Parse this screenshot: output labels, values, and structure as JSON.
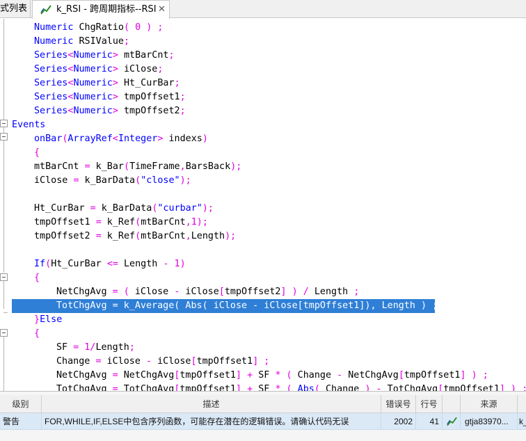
{
  "tabs": [
    {
      "label": "式列表"
    },
    {
      "label": "k_RSI - 跨周期指标--RSI",
      "close": "✕"
    }
  ],
  "code_lines": [
    {
      "indent": 1,
      "parts": [
        [
          "kw",
          "Numeric"
        ],
        [
          "fn",
          " ChgRatio"
        ],
        [
          "op",
          "( 0 ) ;"
        ]
      ]
    },
    {
      "indent": 1,
      "parts": [
        [
          "kw",
          "Numeric"
        ],
        [
          "fn",
          " RSIValue"
        ],
        [
          "op",
          ";"
        ]
      ]
    },
    {
      "indent": 1,
      "parts": [
        [
          "kw",
          "Series"
        ],
        [
          "op",
          "<"
        ],
        [
          "kw",
          "Numeric"
        ],
        [
          "op",
          ">"
        ],
        [
          "fn",
          " mtBarCnt"
        ],
        [
          "op",
          ";"
        ]
      ]
    },
    {
      "indent": 1,
      "parts": [
        [
          "kw",
          "Series"
        ],
        [
          "op",
          "<"
        ],
        [
          "kw",
          "Numeric"
        ],
        [
          "op",
          ">"
        ],
        [
          "fn",
          " iClose"
        ],
        [
          "op",
          ";"
        ]
      ]
    },
    {
      "indent": 1,
      "parts": [
        [
          "kw",
          "Series"
        ],
        [
          "op",
          "<"
        ],
        [
          "kw",
          "Numeric"
        ],
        [
          "op",
          ">"
        ],
        [
          "fn",
          " Ht_CurBar"
        ],
        [
          "op",
          ";"
        ]
      ]
    },
    {
      "indent": 1,
      "parts": [
        [
          "kw",
          "Series"
        ],
        [
          "op",
          "<"
        ],
        [
          "kw",
          "Numeric"
        ],
        [
          "op",
          ">"
        ],
        [
          "fn",
          " tmpOffset1"
        ],
        [
          "op",
          ";"
        ]
      ]
    },
    {
      "indent": 1,
      "parts": [
        [
          "kw",
          "Series"
        ],
        [
          "op",
          "<"
        ],
        [
          "kw",
          "Numeric"
        ],
        [
          "op",
          ">"
        ],
        [
          "fn",
          " tmpOffset2"
        ],
        [
          "op",
          ";"
        ]
      ]
    },
    {
      "indent": 0,
      "parts": [
        [
          "kw",
          "Events"
        ]
      ]
    },
    {
      "indent": 1,
      "parts": [
        [
          "kw",
          "onBar"
        ],
        [
          "op",
          "("
        ],
        [
          "kw",
          "ArrayRef"
        ],
        [
          "op",
          "<"
        ],
        [
          "kw",
          "Integer"
        ],
        [
          "op",
          ">"
        ],
        [
          "fn",
          " indexs"
        ],
        [
          "op",
          ")"
        ]
      ]
    },
    {
      "indent": 1,
      "parts": [
        [
          "op",
          "{"
        ]
      ]
    },
    {
      "indent": 1,
      "parts": [
        [
          "fn",
          "mtBarCnt "
        ],
        [
          "op",
          "="
        ],
        [
          "fn",
          " k_Bar"
        ],
        [
          "op",
          "("
        ],
        [
          "fn",
          "TimeFrame"
        ],
        [
          "op",
          ","
        ],
        [
          "fn",
          "BarsBack"
        ],
        [
          "op",
          ");"
        ]
      ]
    },
    {
      "indent": 1,
      "parts": [
        [
          "fn",
          "iClose "
        ],
        [
          "op",
          "="
        ],
        [
          "fn",
          " k_BarData"
        ],
        [
          "op",
          "("
        ],
        [
          "str",
          "\"close\""
        ],
        [
          "op",
          ");"
        ]
      ]
    },
    {
      "indent": 1,
      "parts": []
    },
    {
      "indent": 1,
      "parts": [
        [
          "fn",
          "Ht_CurBar "
        ],
        [
          "op",
          "="
        ],
        [
          "fn",
          " k_BarData"
        ],
        [
          "op",
          "("
        ],
        [
          "str",
          "\"curbar\""
        ],
        [
          "op",
          ");"
        ]
      ]
    },
    {
      "indent": 1,
      "parts": [
        [
          "fn",
          "tmpOffset1 "
        ],
        [
          "op",
          "="
        ],
        [
          "fn",
          " k_Ref"
        ],
        [
          "op",
          "("
        ],
        [
          "fn",
          "mtBarCnt"
        ],
        [
          "op",
          ",1);"
        ]
      ]
    },
    {
      "indent": 1,
      "parts": [
        [
          "fn",
          "tmpOffset2 "
        ],
        [
          "op",
          "="
        ],
        [
          "fn",
          " k_Ref"
        ],
        [
          "op",
          "("
        ],
        [
          "fn",
          "mtBarCnt"
        ],
        [
          "op",
          ","
        ],
        [
          "fn",
          "Length"
        ],
        [
          "op",
          ");"
        ]
      ]
    },
    {
      "indent": 1,
      "parts": []
    },
    {
      "indent": 1,
      "parts": [
        [
          "kw",
          "If"
        ],
        [
          "op",
          "("
        ],
        [
          "fn",
          "Ht_CurBar "
        ],
        [
          "op",
          "<="
        ],
        [
          "fn",
          " Length "
        ],
        [
          "op",
          "- 1)"
        ]
      ]
    },
    {
      "indent": 1,
      "parts": [
        [
          "op",
          "{"
        ]
      ]
    },
    {
      "indent": 2,
      "parts": [
        [
          "fn",
          "NetChgAvg "
        ],
        [
          "op",
          "= ("
        ],
        [
          "fn",
          " iClose "
        ],
        [
          "op",
          "-"
        ],
        [
          "fn",
          " iClose"
        ],
        [
          "op",
          "["
        ],
        [
          "fn",
          "tmpOffset2"
        ],
        [
          "op",
          "] ) /"
        ],
        [
          "fn",
          " Length "
        ],
        [
          "op",
          ";"
        ]
      ]
    },
    {
      "indent": 2,
      "selected": true,
      "parts": [
        [
          "fn",
          "TotChgAvg = k_Average( Abs( iClose - iClose[tmpOffset1]), Length ) ;"
        ]
      ]
    },
    {
      "indent": 1,
      "parts": [
        [
          "op",
          "}"
        ],
        [
          "kw",
          "Else"
        ]
      ]
    },
    {
      "indent": 1,
      "parts": [
        [
          "op",
          "{"
        ]
      ]
    },
    {
      "indent": 2,
      "parts": [
        [
          "fn",
          "SF "
        ],
        [
          "op",
          "= 1/"
        ],
        [
          "fn",
          "Length"
        ],
        [
          "op",
          ";"
        ]
      ]
    },
    {
      "indent": 2,
      "parts": [
        [
          "fn",
          "Change "
        ],
        [
          "op",
          "="
        ],
        [
          "fn",
          " iClose "
        ],
        [
          "op",
          "-"
        ],
        [
          "fn",
          " iClose"
        ],
        [
          "op",
          "["
        ],
        [
          "fn",
          "tmpOffset1"
        ],
        [
          "op",
          "] ;"
        ]
      ]
    },
    {
      "indent": 2,
      "parts": [
        [
          "fn",
          "NetChgAvg "
        ],
        [
          "op",
          "="
        ],
        [
          "fn",
          " NetChgAvg"
        ],
        [
          "op",
          "["
        ],
        [
          "fn",
          "tmpOffset1"
        ],
        [
          "op",
          "] +"
        ],
        [
          "fn",
          " SF "
        ],
        [
          "op",
          "* ("
        ],
        [
          "fn",
          " Change "
        ],
        [
          "op",
          "-"
        ],
        [
          "fn",
          " NetChgAvg"
        ],
        [
          "op",
          "["
        ],
        [
          "fn",
          "tmpOffset1"
        ],
        [
          "op",
          "] ) ;"
        ]
      ]
    },
    {
      "indent": 2,
      "parts": [
        [
          "fn",
          "TotChgAvg "
        ],
        [
          "op",
          "="
        ],
        [
          "fn",
          " TotChgAvg"
        ],
        [
          "op",
          "["
        ],
        [
          "fn",
          "tmpOffset1"
        ],
        [
          "op",
          "] +"
        ],
        [
          "fn",
          " SF "
        ],
        [
          "op",
          "* ("
        ],
        [
          "kw",
          " Abs"
        ],
        [
          "op",
          "("
        ],
        [
          "fn",
          " Change "
        ],
        [
          "op",
          ") -"
        ],
        [
          "fn",
          " TotChgAvg"
        ],
        [
          "op",
          "["
        ],
        [
          "fn",
          "tmpOffset1"
        ],
        [
          "op",
          "] ) ;"
        ]
      ]
    }
  ],
  "panel": {
    "headers": [
      "级别",
      "描述",
      "错误号",
      "行号",
      "",
      "来源",
      ""
    ],
    "rows": [
      {
        "level": "警告",
        "description": "FOR,WHILE,IF,ELSE中包含序列函数，可能存在潜在的逻辑错误。请确认代码无误",
        "code": "2002",
        "line": "41",
        "icon": "indicator-icon",
        "source": "gtja83970...",
        "extra": "k_"
      }
    ]
  },
  "colors": {
    "keyword": "#0000ff",
    "operator": "#e000e0",
    "selection": "#2f7fd6",
    "row_highlight": "#dbe9f7"
  }
}
